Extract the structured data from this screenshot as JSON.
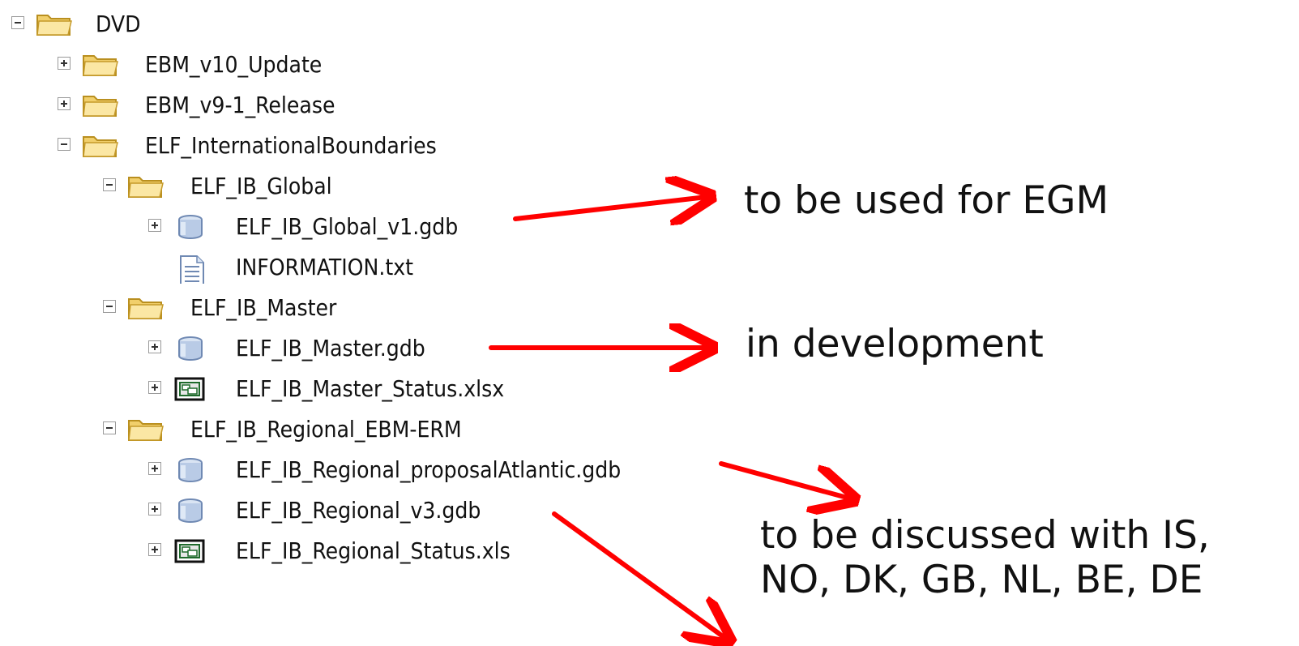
{
  "tree": {
    "dvd": "DVD",
    "ebm_v10": "EBM_v10_Update",
    "ebm_v9": "EBM_v9-1_Release",
    "elf_ib": "ELF_InternationalBoundaries",
    "global": "ELF_IB_Global",
    "global_gdb": "ELF_IB_Global_v1.gdb",
    "information": "INFORMATION.txt",
    "master": "ELF_IB_Master",
    "master_gdb": "ELF_IB_Master.gdb",
    "master_status": "ELF_IB_Master_Status.xlsx",
    "regional": "ELF_IB_Regional_EBM-ERM",
    "regional_proposal": "ELF_IB_Regional_proposalAtlantic.gdb",
    "regional_v3": "ELF_IB_Regional_v3.gdb",
    "regional_status": "ELF_IB_Regional_Status.xls"
  },
  "annotations": {
    "egm": "to be used for EGM",
    "development": "in development",
    "discussed_line1": "to be discussed with IS,",
    "discussed_line2": "NO, DK, GB, NL, BE, DE"
  },
  "colors": {
    "arrow": "#ff0000",
    "folder_body": "#f5d77a",
    "folder_edge": "#c8a02a",
    "db": "#8aa9d6",
    "excel_frame": "#1f6b2c"
  }
}
